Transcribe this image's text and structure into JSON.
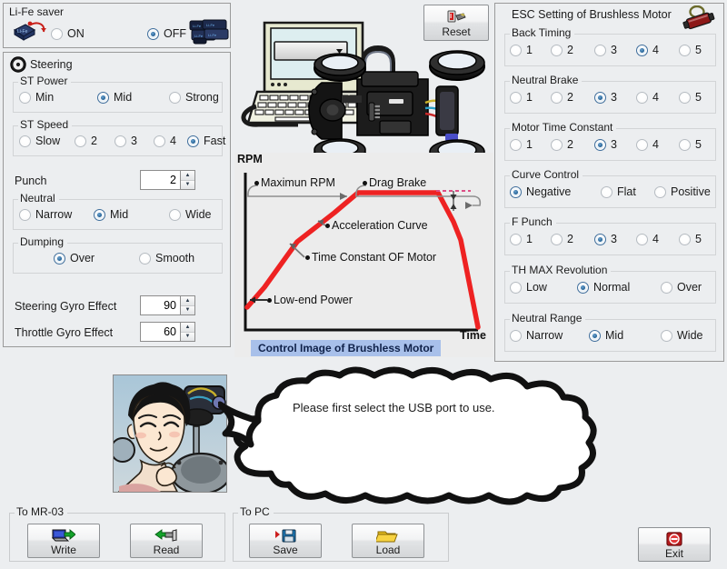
{
  "window": {
    "background": "#eceef0"
  },
  "lifesaver": {
    "title": "Li-Fe saver",
    "options": [
      {
        "label": "ON",
        "selected": false
      },
      {
        "label": "OFF",
        "selected": true
      }
    ],
    "left_icon": "lipo-battery-warning-icon",
    "right_icon": "battery-pack-icon"
  },
  "steering": {
    "title": "Steering",
    "icon": "steering-servo-icon",
    "groups": [
      {
        "legend": "ST Power",
        "options": [
          {
            "label": "Min",
            "selected": false
          },
          {
            "label": "Mid",
            "selected": true
          },
          {
            "label": "Strong",
            "selected": false
          }
        ]
      },
      {
        "legend": "ST Speed",
        "options": [
          {
            "label": "Slow",
            "selected": false
          },
          {
            "label": "2",
            "selected": false
          },
          {
            "label": "3",
            "selected": false
          },
          {
            "label": "4",
            "selected": false
          },
          {
            "label": "Fast",
            "selected": true
          }
        ]
      },
      {
        "legend": "Neutral",
        "options": [
          {
            "label": "Narrow",
            "selected": false
          },
          {
            "label": "Mid",
            "selected": true
          },
          {
            "label": "Wide",
            "selected": false
          }
        ]
      },
      {
        "legend": "Dumping",
        "options": [
          {
            "label": "Over",
            "selected": true
          },
          {
            "label": "Smooth",
            "selected": false
          }
        ]
      }
    ],
    "fields": [
      {
        "label": "Punch",
        "value": "2"
      },
      {
        "label": "Steering Gyro Effect",
        "value": "90"
      },
      {
        "label": "Throttle Gyro Effect",
        "value": "60"
      }
    ]
  },
  "esc": {
    "title": "ESC Setting of Brushless Motor",
    "icon": "brushless-motor-icon",
    "groups": [
      {
        "legend": "Back Timing",
        "options": [
          {
            "label": "1",
            "selected": false
          },
          {
            "label": "2",
            "selected": false
          },
          {
            "label": "3",
            "selected": false
          },
          {
            "label": "4",
            "selected": true
          },
          {
            "label": "5",
            "selected": false
          }
        ]
      },
      {
        "legend": "Neutral Brake",
        "options": [
          {
            "label": "1",
            "selected": false
          },
          {
            "label": "2",
            "selected": false
          },
          {
            "label": "3",
            "selected": true
          },
          {
            "label": "4",
            "selected": false
          },
          {
            "label": "5",
            "selected": false
          }
        ]
      },
      {
        "legend": "Motor Time Constant",
        "options": [
          {
            "label": "1",
            "selected": false
          },
          {
            "label": "2",
            "selected": false
          },
          {
            "label": "3",
            "selected": true
          },
          {
            "label": "4",
            "selected": false
          },
          {
            "label": "5",
            "selected": false
          }
        ]
      },
      {
        "legend": "Curve Control",
        "options": [
          {
            "label": "Negative",
            "selected": true
          },
          {
            "label": "Flat",
            "selected": false
          },
          {
            "label": "Positive",
            "selected": false
          }
        ]
      },
      {
        "legend": "F Punch",
        "options": [
          {
            "label": "1",
            "selected": false
          },
          {
            "label": "2",
            "selected": false
          },
          {
            "label": "3",
            "selected": true
          },
          {
            "label": "4",
            "selected": false
          },
          {
            "label": "5",
            "selected": false
          }
        ]
      },
      {
        "legend": "TH MAX Revolution",
        "options": [
          {
            "label": "Low",
            "selected": false
          },
          {
            "label": "Normal",
            "selected": true
          },
          {
            "label": "Over",
            "selected": false
          }
        ]
      },
      {
        "legend": "Neutral Range",
        "options": [
          {
            "label": "Narrow",
            "selected": false
          },
          {
            "label": "Mid",
            "selected": true
          },
          {
            "label": "Wide",
            "selected": false
          }
        ]
      }
    ]
  },
  "reset_button": {
    "label": "Reset",
    "icon": "reset-battery-icon"
  },
  "illustration": {
    "laptop": "laptop-with-dropdown-illustration",
    "chassis": "rc-car-chassis-illustration",
    "dropdown_value": ""
  },
  "chart_data": {
    "type": "line",
    "title": "Control Image of Brushless Motor",
    "xlabel": "Time",
    "ylabel": "RPM",
    "grid": false,
    "series": [
      {
        "name": "RPM curve",
        "color": "#ee2222",
        "points": [
          {
            "x": 0,
            "y": 14
          },
          {
            "x": 8,
            "y": 26
          },
          {
            "x": 17,
            "y": 45
          },
          {
            "x": 22,
            "y": 56
          },
          {
            "x": 38,
            "y": 75
          },
          {
            "x": 48,
            "y": 92
          },
          {
            "x": 83,
            "y": 92
          },
          {
            "x": 90,
            "y": 70
          },
          {
            "x": 93,
            "y": 58
          },
          {
            "x": 100,
            "y": 2
          }
        ]
      }
    ],
    "annotations": [
      {
        "label": "Maximun RPM",
        "target": "plateau-start"
      },
      {
        "label": "Drag Brake",
        "target": "decel-offset"
      },
      {
        "label": "Acceleration Curve",
        "target": "rising-slope"
      },
      {
        "label": "Time Constant OF Motor",
        "target": "knee-point"
      },
      {
        "label": "Low-end Power",
        "target": "curve-origin"
      }
    ]
  },
  "message": {
    "text": "Please first select the USB port to use.",
    "avatar": "technician-character-avatar"
  },
  "footer": {
    "groups": [
      {
        "legend": "To MR-03",
        "buttons": [
          {
            "label": "Write",
            "icon": "write-to-device-icon"
          },
          {
            "label": "Read",
            "icon": "read-from-device-icon"
          }
        ]
      },
      {
        "legend": "To PC",
        "buttons": [
          {
            "label": "Save",
            "icon": "floppy-save-icon"
          },
          {
            "label": "Load",
            "icon": "folder-open-icon"
          }
        ]
      }
    ],
    "exit_button": {
      "label": "Exit",
      "icon": "stop-exit-icon"
    }
  }
}
